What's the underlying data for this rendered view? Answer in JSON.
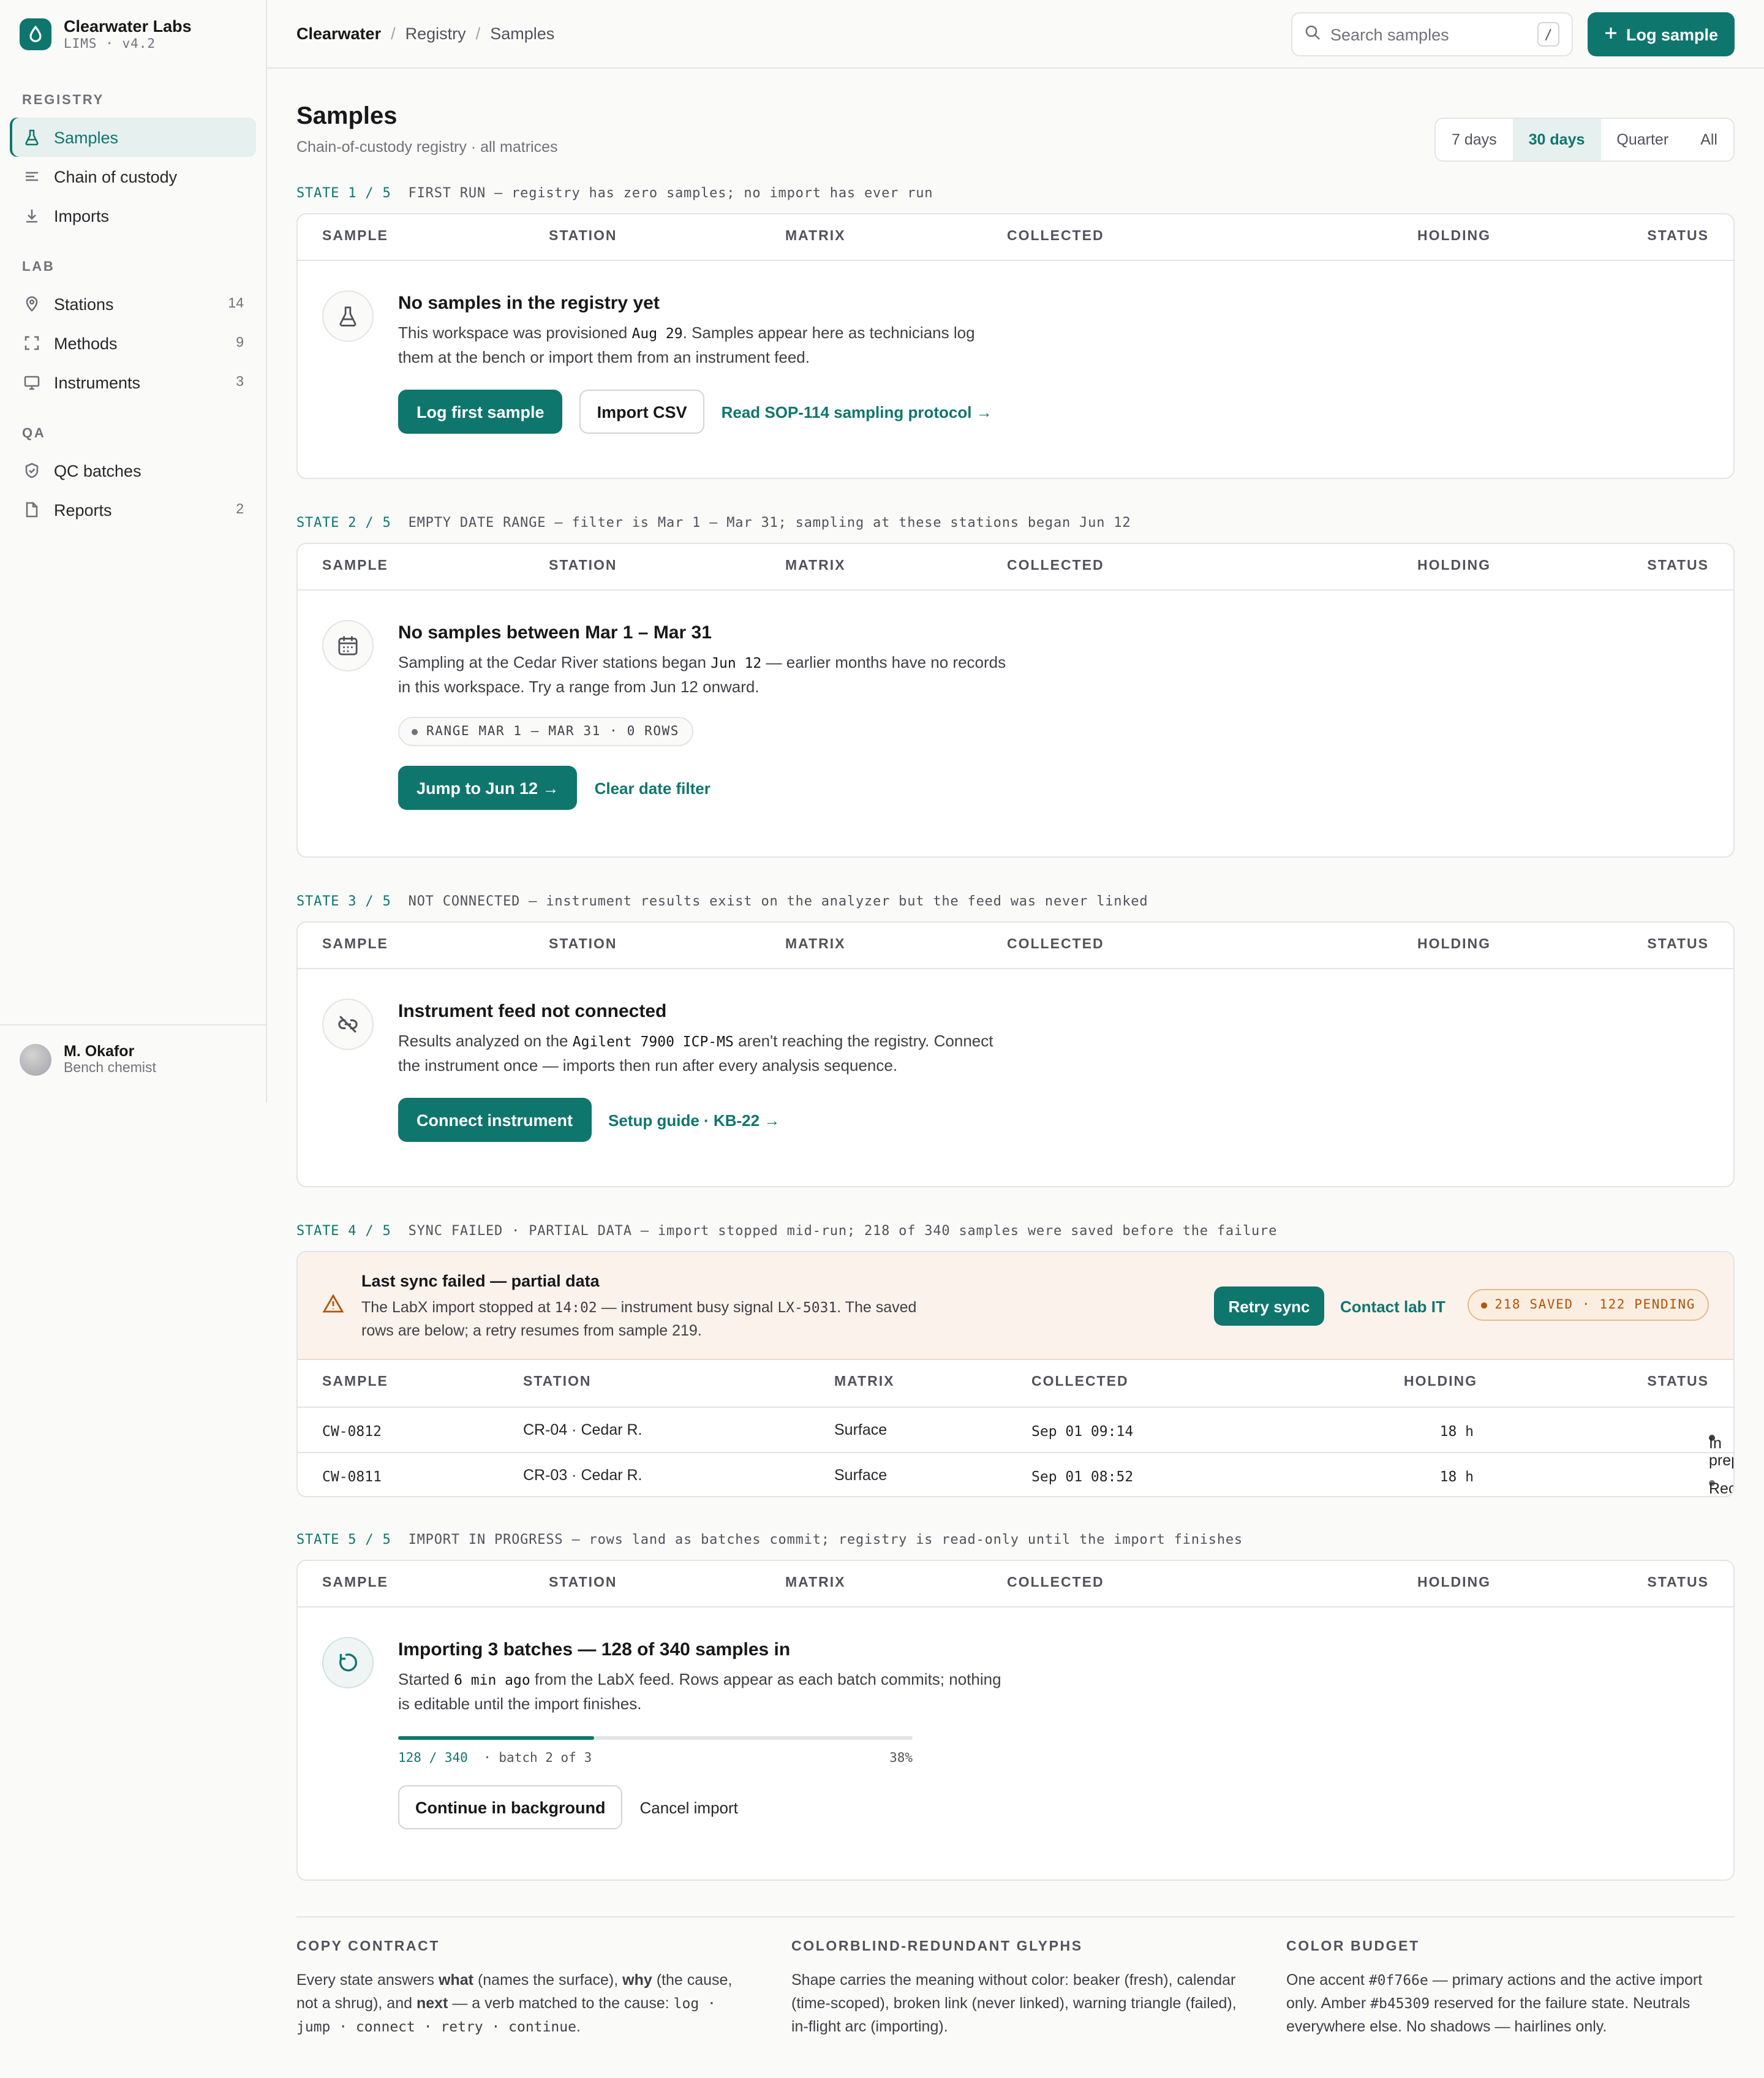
{
  "brand": {
    "name": "Clearwater Labs",
    "sub": "LIMS · v4.2"
  },
  "sidebar": {
    "sections": [
      {
        "title": "REGISTRY",
        "items": [
          {
            "label": "Samples",
            "icon": "beaker-icon",
            "count": ""
          },
          {
            "label": "Chain of custody",
            "icon": "list-icon",
            "count": ""
          },
          {
            "label": "Imports",
            "icon": "download-icon",
            "count": ""
          }
        ]
      },
      {
        "title": "LAB",
        "items": [
          {
            "label": "Stations",
            "icon": "map-pin-icon",
            "count": "14"
          },
          {
            "label": "Methods",
            "icon": "bracket-frame-icon",
            "count": "9"
          },
          {
            "label": "Instruments",
            "icon": "monitor-icon",
            "count": "3"
          }
        ]
      },
      {
        "title": "QA",
        "items": [
          {
            "label": "QC batches",
            "icon": "shield-check-icon",
            "count": ""
          },
          {
            "label": "Reports",
            "icon": "document-icon",
            "count": "2"
          }
        ]
      }
    ],
    "user": {
      "name": "M. Okafor",
      "role": "Bench chemist"
    }
  },
  "topbar": {
    "breadcrumb": [
      "Clearwater",
      "Registry",
      "Samples"
    ],
    "search_placeholder": "Search samples",
    "search_shortcut": "/",
    "log_button": "Log sample"
  },
  "page": {
    "title": "Samples",
    "subtitle": "Chain-of-custody registry · all matrices",
    "ranges": [
      "7 days",
      "30 days",
      "Quarter",
      "All"
    ],
    "active_range": "30 days"
  },
  "columns": [
    "SAMPLE",
    "STATION",
    "MATRIX",
    "COLLECTED",
    "HOLDING",
    "STATUS"
  ],
  "states": {
    "s1": {
      "label_num": "STATE 1 / 5",
      "label_text": "FIRST RUN — registry has zero samples; no import has ever run",
      "title": "No samples in the registry yet",
      "text_a": "This workspace was provisioned ",
      "text_code": "Aug 29",
      "text_b": ". Samples appear here as technicians log them at the bench or import them from an instrument feed.",
      "primary": "Log first sample",
      "secondary": "Import CSV",
      "link": "Read SOP-114 sampling protocol →"
    },
    "s2": {
      "label_num": "STATE 2 / 5",
      "label_text": "EMPTY DATE RANGE — filter is Mar 1 – Mar 31; sampling at these stations began Jun 12",
      "title": "No samples between Mar 1 – Mar 31",
      "text_a": "Sampling at the Cedar River stations began ",
      "text_code": "Jun 12",
      "text_b": " — earlier months have no records in this workspace. Try a range from Jun 12 onward.",
      "pill": "RANGE MAR 1 – MAR 31 · 0 ROWS",
      "primary": "Jump to Jun 12 →",
      "link": "Clear date filter"
    },
    "s3": {
      "label_num": "STATE 3 / 5",
      "label_text": "NOT CONNECTED — instrument results exist on the analyzer but the feed was never linked",
      "title": "Instrument feed not connected",
      "text_a": "Results analyzed on the ",
      "text_code": "Agilent 7900 ICP-MS",
      "text_b": " aren't reaching the registry. Connect the instrument once — imports then run after every analysis sequence.",
      "primary": "Connect instrument",
      "link": "Setup guide · KB-22 →"
    },
    "s4": {
      "label_num": "STATE 4 / 5",
      "label_text": "SYNC FAILED · PARTIAL DATA — import stopped mid-run; 218 of 340 samples were saved before the failure",
      "title": "Last sync failed — partial data",
      "text_a": "The LabX import stopped at ",
      "text_code1": "14:02",
      "text_b": " — instrument busy signal ",
      "text_code2": "LX-5031",
      "text_c": ". The saved rows are below; a retry resumes from sample 219.",
      "primary": "Retry sync",
      "link": "Contact lab IT",
      "pill": "218 SAVED · 122 PENDING",
      "rows": [
        {
          "sample": "CW-0812",
          "station": "CR-04 · Cedar R.",
          "matrix": "Surface",
          "collected": "Sep 01 09:14",
          "holding": "18 h",
          "status": "In prep"
        },
        {
          "sample": "CW-0811",
          "station": "CR-03 · Cedar R.",
          "matrix": "Surface",
          "collected": "Sep 01 08:52",
          "holding": "18 h",
          "status": "Received"
        }
      ]
    },
    "s5": {
      "label_num": "STATE 5 / 5",
      "label_text": "IMPORT IN PROGRESS — rows land as batches commit; registry is read-only until the import finishes",
      "title": "Importing 3 batches — 128 of 340 samples in",
      "text_a": "Started ",
      "text_code": "6 min ago",
      "text_b": " from the LabX feed. Rows appear as each batch commits; nothing is editable until the import finishes.",
      "progress_value": 0.38,
      "progress_count": "128 / 340",
      "progress_batch": "· batch 2 of 3",
      "progress_pct": "38%",
      "secondary": "Continue in background",
      "link": "Cancel import"
    }
  },
  "footer": [
    {
      "title": "COPY CONTRACT"
    },
    {
      "title": "COLORBLIND-REDUNDANT GLYPHS",
      "text": "Shape carries the meaning without color: beaker (fresh), calendar (time-scoped), broken link (never linked), warning triangle (failed), in-flight arc (importing)."
    },
    {
      "title": "COLOR BUDGET",
      "text_a": "One accent ",
      "code1": "#0f766e",
      "text_b": " — primary actions and the active import only. Amber ",
      "code2": "#b45309",
      "text_c": " reserved for the failure state. Neutrals everywhere else. No shadows — hairlines only."
    }
  ],
  "footer_copy": {
    "a": "Every state answers ",
    "what": "what",
    "b": " (names the surface), ",
    "why": "why",
    "c": " (the cause, not a shrug), and ",
    "next": "next",
    "d": " — a verb matched to the cause: ",
    "code": "log · jump · connect · retry · continue",
    "e": "."
  },
  "colors": {
    "accent": "#0f766e",
    "amber": "#b45309"
  }
}
